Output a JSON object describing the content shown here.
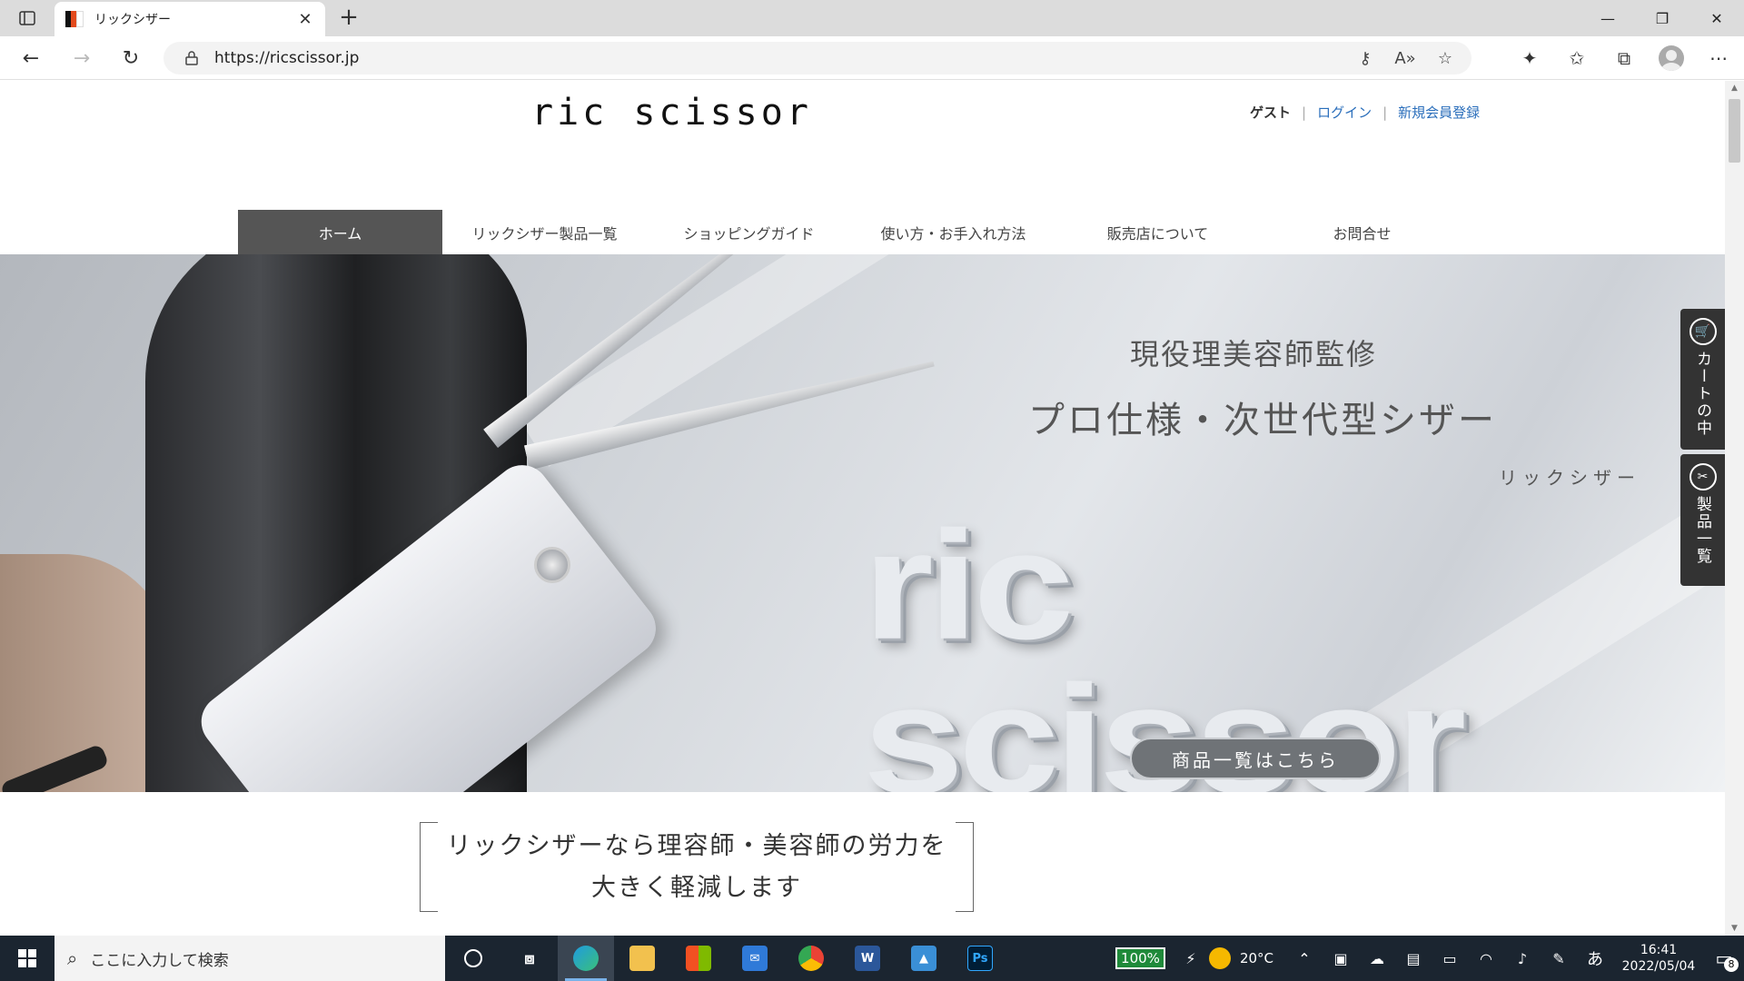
{
  "browser": {
    "tab_title": "リックシザー",
    "url": "https://ricscissor.jp",
    "favicon_colors": [
      "#111111",
      "#e34a1c",
      "#ffffff"
    ]
  },
  "site": {
    "logo": "ric scissor",
    "user": {
      "guest": "ゲスト",
      "login": "ログイン",
      "register": "新規会員登録"
    },
    "nav": [
      "ホーム",
      "リックシザー製品一覧",
      "ショッピングガイド",
      "使い方・お手入れ方法",
      "販売店について",
      "お問合せ"
    ],
    "hero": {
      "subtitle": "現役理美容師監修",
      "title": "プロ仕様・次世代型シザー",
      "kana": "リックシザー",
      "logo_text": "ric scissor",
      "cta": "商品一覧はこちら"
    },
    "side_tabs": {
      "cart": "カートの中",
      "products": "製品一覧"
    },
    "tagline": {
      "line1": "リックシザーなら理容師・美容師の労力を",
      "line2": "大きく軽減します"
    }
  },
  "taskbar": {
    "search_placeholder": "ここに入力して検索",
    "battery": "100%",
    "weather": "20°C",
    "ime": "あ",
    "time": "16:41",
    "date": "2022/05/04",
    "notifications": "8"
  },
  "colors": {
    "nav_active": "#555555",
    "link": "#2a6ebb",
    "taskbar": "#1b2530"
  }
}
